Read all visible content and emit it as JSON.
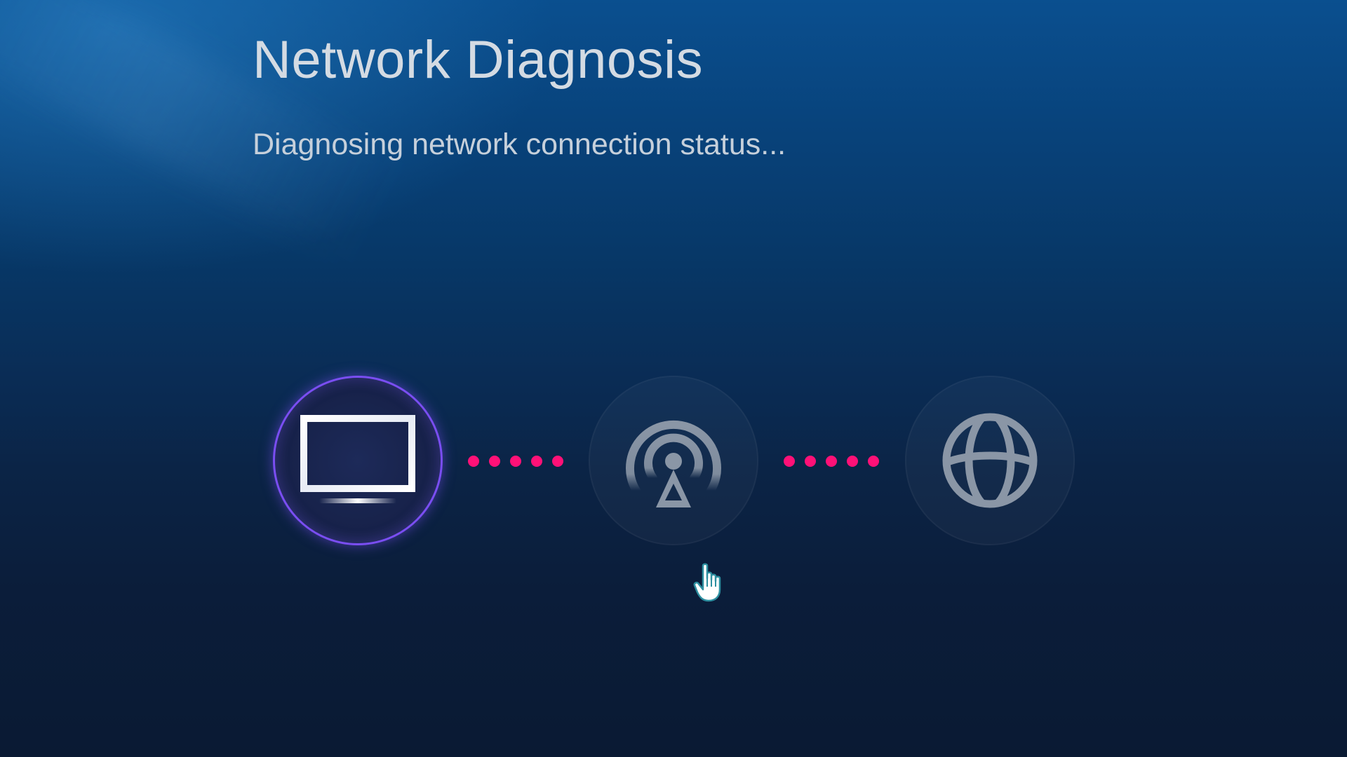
{
  "header": {
    "title": "Network Diagnosis",
    "subtitle": "Diagnosing network connection status..."
  },
  "diagnosis": {
    "steps": [
      {
        "name": "tv",
        "icon": "tv-icon",
        "state": "active"
      },
      {
        "name": "router",
        "icon": "wireless-router-icon",
        "state": "pending"
      },
      {
        "name": "internet",
        "icon": "globe-icon",
        "state": "pending"
      }
    ],
    "connector_dot_count": 5
  },
  "colors": {
    "accent_ring": "#7a4ef2",
    "connector_dot": "#ff1177",
    "text_primary": "#d4dbe3",
    "icon_idle": "#8a96a6"
  },
  "cursor": {
    "icon": "hand-pointer-icon"
  }
}
